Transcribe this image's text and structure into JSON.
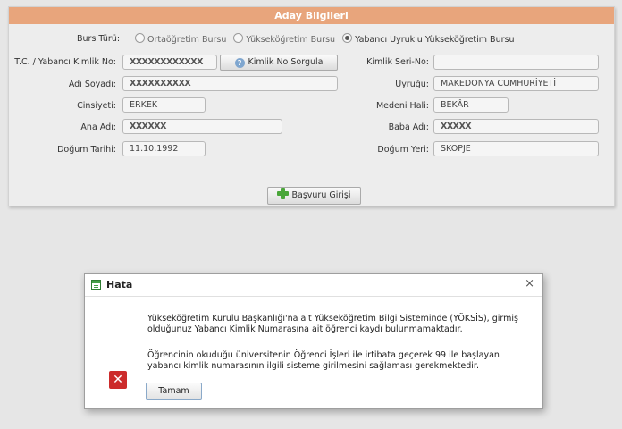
{
  "form": {
    "title": "Aday Bilgileri",
    "burs_turu_label": "Burs Türü:",
    "burs_options": [
      {
        "label": "Ortaöğretim Bursu",
        "selected": false
      },
      {
        "label": "Yükseköğretim Bursu",
        "selected": false
      },
      {
        "label": "Yabancı Uyruklu Yükseköğretim Bursu",
        "selected": true
      }
    ],
    "tc_label": "T.C. / Yabancı Kimlik No:",
    "tc_value": "XXXXXXXXXXXX",
    "kimlik_sorgula_label": "Kimlik No Sorgula",
    "seri_label": "Kimlik Seri-No:",
    "seri_value": "",
    "ad_soyad_label": "Adı Soyadı:",
    "ad_soyad_value": "XXXXXXXXXX",
    "uyruk_label": "Uyruğu:",
    "uyruk_value": "MAKEDONYA CUMHURİYETİ",
    "cinsiyet_label": "Cinsiyeti:",
    "cinsiyet_value": "ERKEK",
    "medeni_label": "Medeni Hali:",
    "medeni_value": "BEKÂR",
    "ana_label": "Ana Adı:",
    "ana_value": "XXXXXX",
    "baba_label": "Baba Adı:",
    "baba_value": "XXXXX",
    "dogum_tarihi_label": "Doğum Tarihi:",
    "dogum_tarihi_value": "11.10.1992",
    "dogum_yeri_label": "Doğum Yeri:",
    "dogum_yeri_value": "SKOPJE",
    "basvuru_label": "Başvuru Girişi"
  },
  "dialog": {
    "title": "Hata",
    "close_label": "×",
    "message_1": "Yükseköğretim Kurulu Başkanlığı'na ait Yükseköğretim Bilgi Sisteminde (YÖKSİS), girmiş olduğunuz Yabancı Kimlik Numarasına ait öğrenci kaydı bulunmamaktadır.",
    "message_2": "Öğrencinin okuduğu üniversitenin Öğrenci İşleri ile irtibata geçerek 99 ile başlayan yabancı kimlik numarasının ilgili sisteme girilmesini sağlaması gerekmektedir.",
    "ok_label": "Tamam"
  },
  "icons": {
    "help": "question-icon",
    "add": "plus-icon",
    "error": "error-icon",
    "window": "window-icon"
  }
}
